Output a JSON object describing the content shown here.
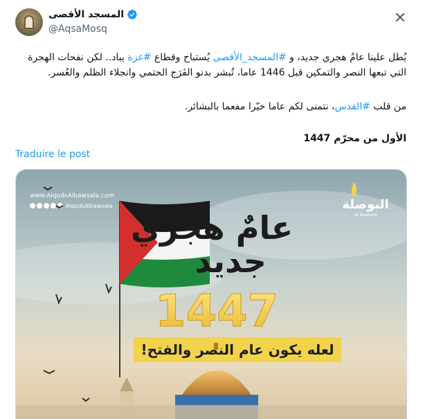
{
  "author": {
    "display_name": "المسجد الأقصى",
    "handle": "@AqsaMosq",
    "verified": true,
    "avatar_icon": "mosque-avatar",
    "menu_icon": "close-icon"
  },
  "post": {
    "p1": {
      "t1": "يُطل علينا عامٌ هجري جديد، و ",
      "h1": "#المسجد_الأقصى",
      "t2": " يُستباح وقطاع ",
      "h2": "#غزة",
      "t3": " يباد.. لكن نفحات الهجرة التي تبعها النصر والتمكين قبل 1446 عاما، تُبشر بدنو الفَرَج الحتمي وانجلاء الظلم والعُسر."
    },
    "p2": {
      "t1": "من قلب ",
      "h1": "#القدس",
      "t2": "، نتمنى لكم عاما خيّرا مفعما بالبشائر."
    },
    "p3": "الأول من محرّم 1447",
    "translate_label": "Traduire le post",
    "hashtag_color": "#1d9bf0"
  },
  "media": {
    "website": "www.AlqudsAlbawsala.com",
    "social_handle": "AlqudsAlbawsala",
    "brand": "البوصلة",
    "brand_sub": "Al Bawsala",
    "headline_1": "عامٌ هجري",
    "headline_2": "جديد",
    "year": "1447",
    "banner": "لعله يكون عام النصر والفتح!",
    "flag_colors": [
      "#000000",
      "#ffffff",
      "#1f8a3c",
      "#d32f2f"
    ],
    "accent_color": "#f2d34c"
  }
}
